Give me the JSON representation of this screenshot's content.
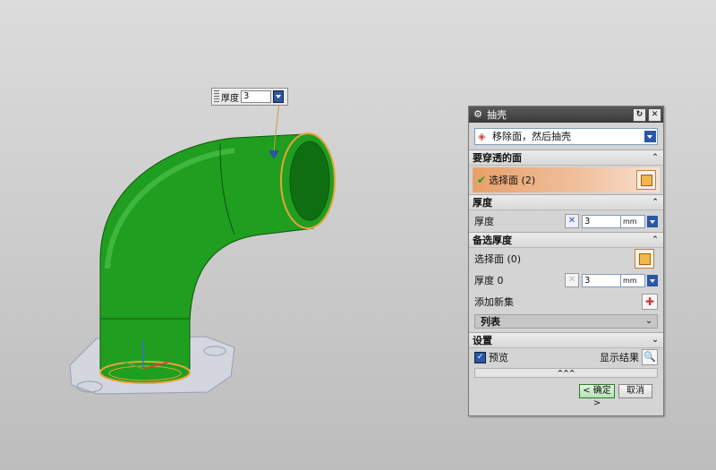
{
  "float_thickness": {
    "label": "厚度",
    "value": "3"
  },
  "dialog": {
    "title": "抽壳",
    "type_value": "移除面，然后抽壳",
    "faces_to_pierce": {
      "header": "要穿透的面",
      "select_label": "选择面 (2)"
    },
    "thickness": {
      "header": "厚度",
      "label": "厚度",
      "value": "3",
      "unit": "mm"
    },
    "alt_thickness": {
      "header": "备选厚度",
      "select_label": "选择面 (0)",
      "thickness_label": "厚度 0",
      "value": "3",
      "unit": "mm",
      "add_set_label": "添加新集",
      "list_label": "列表"
    },
    "settings": {
      "header": "设置"
    },
    "preview": {
      "label": "预览",
      "checked": true,
      "show_result_label": "显示结果"
    },
    "more_label": "^^^",
    "ok_label": "< 确定 >",
    "cancel_label": "取消"
  },
  "colors": {
    "model_green": "#1f9e1f",
    "edge_orange": "#e8a33a",
    "highlight": "#f0c2a0"
  }
}
